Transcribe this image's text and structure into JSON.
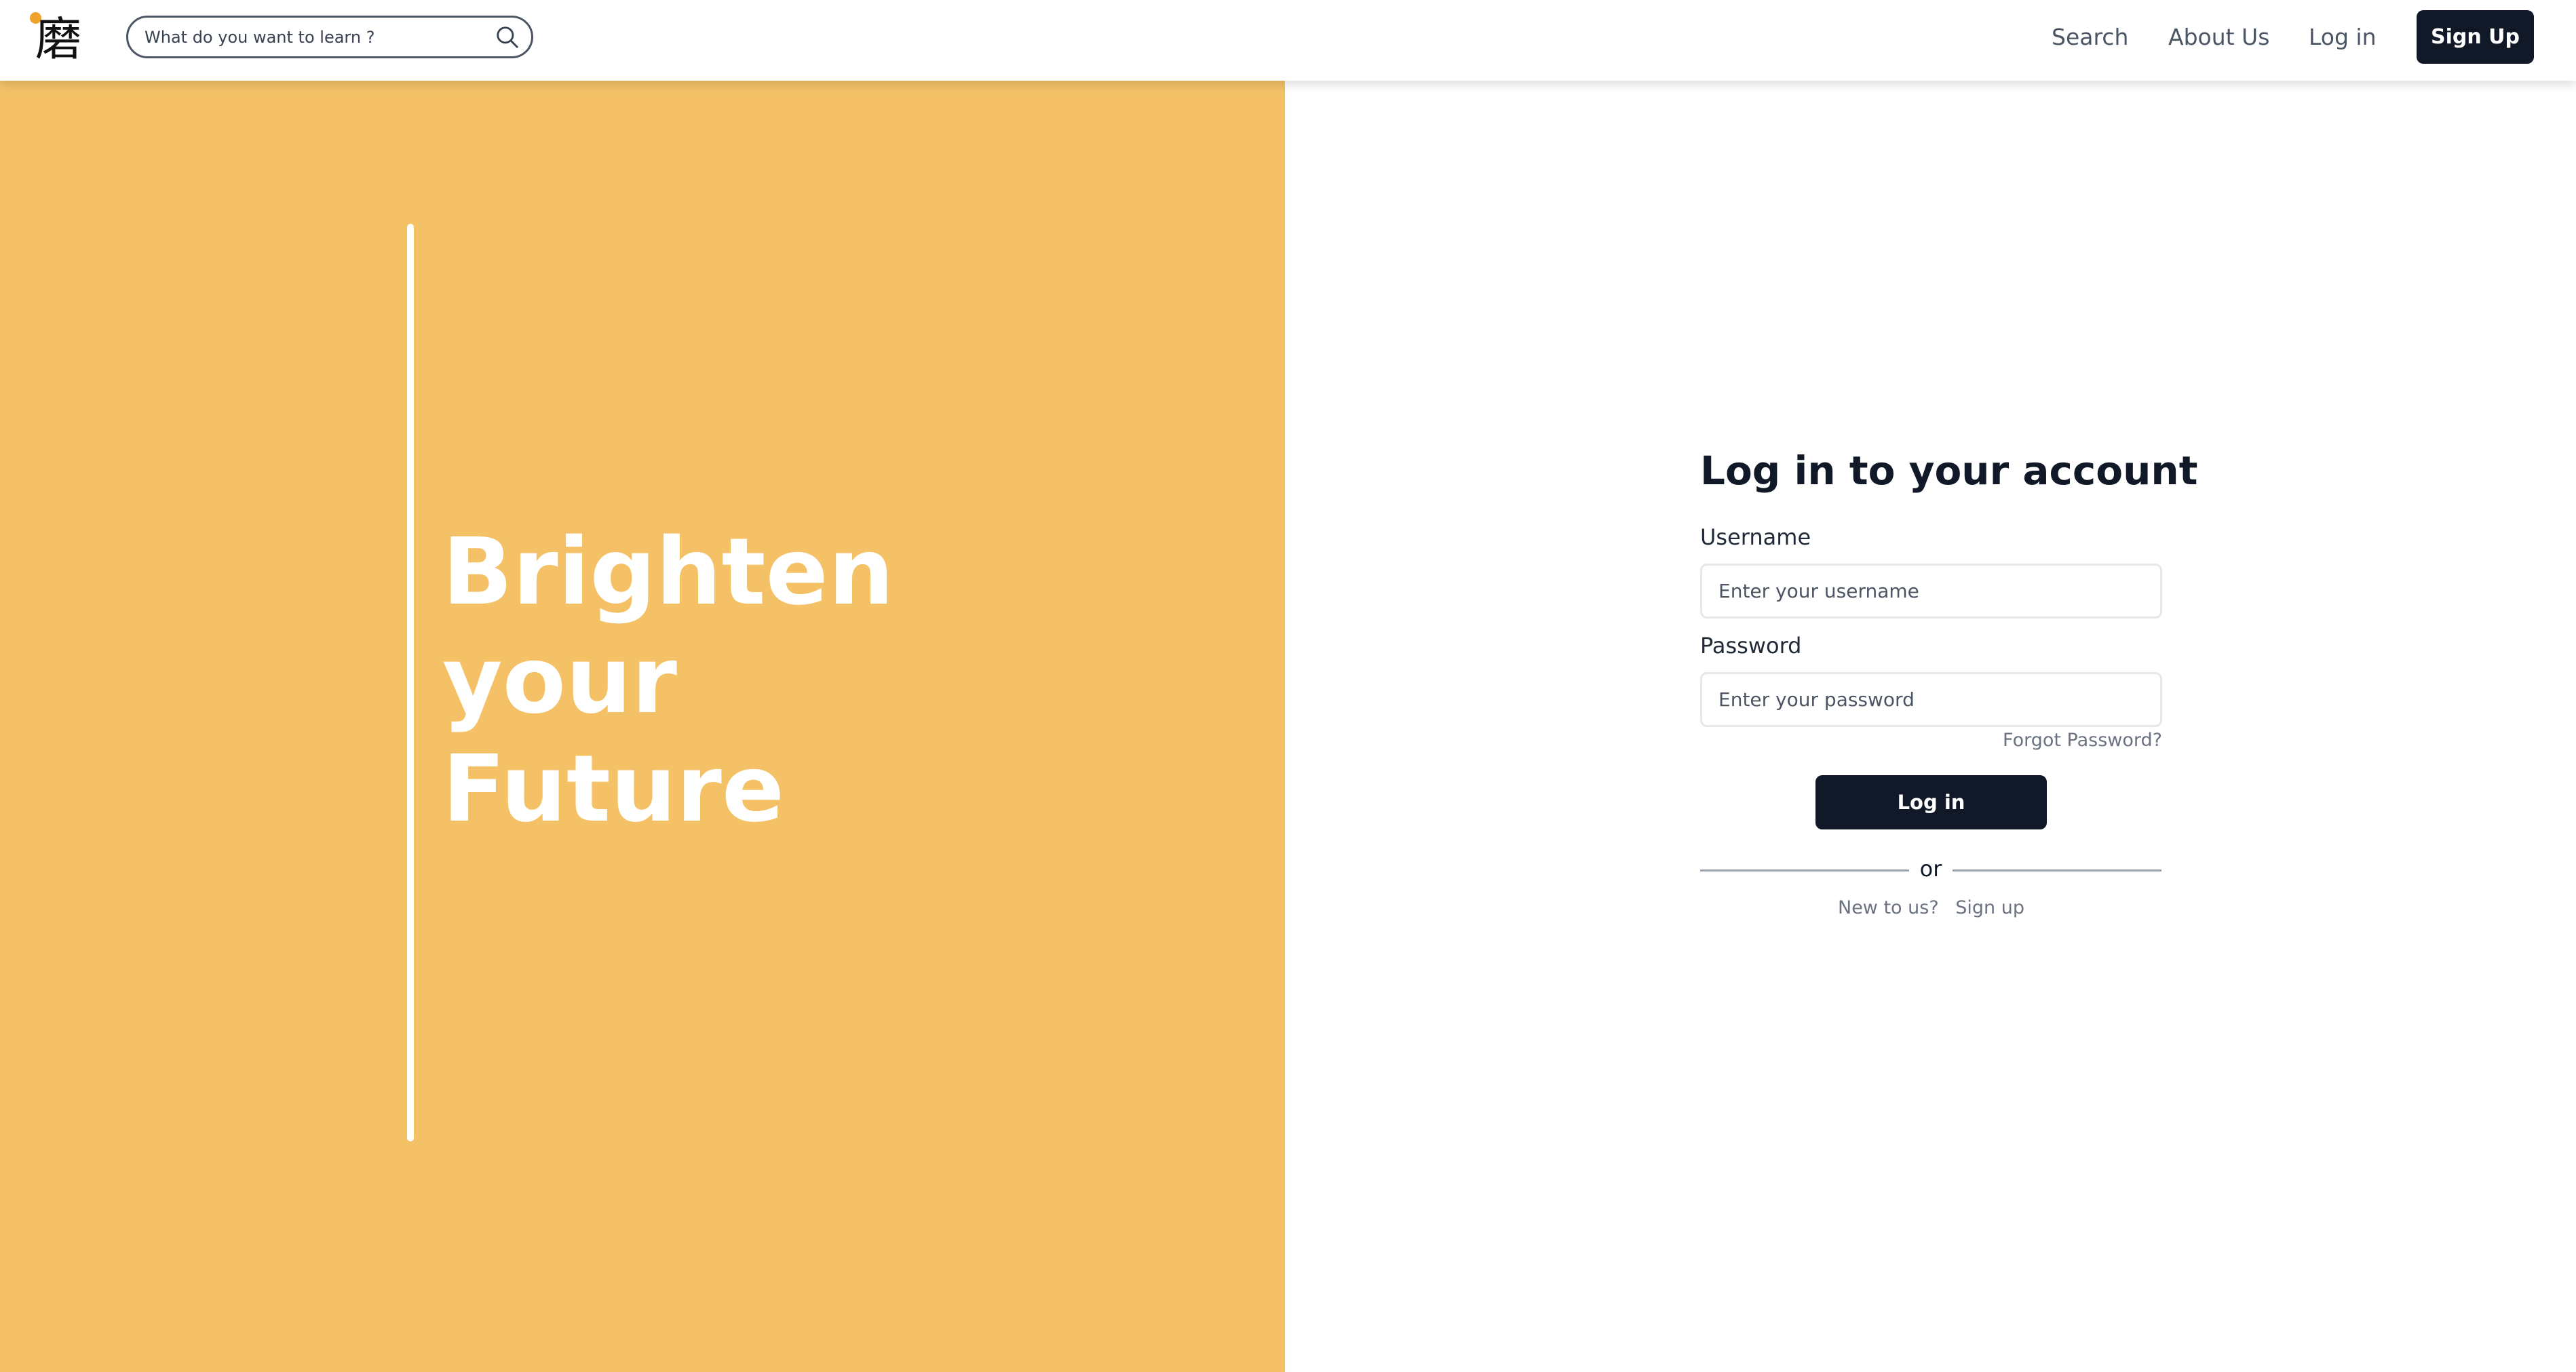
{
  "logo": {
    "glyph": "磨",
    "dot_color": "#f0a32a"
  },
  "search": {
    "placeholder": "What do you want to learn ?",
    "icon": "search-icon"
  },
  "nav": {
    "links": [
      {
        "label": "Search"
      },
      {
        "label": "About Us"
      },
      {
        "label": "Log in"
      }
    ],
    "signup_label": "Sign Up"
  },
  "hero": {
    "lines": [
      "Brighten",
      "your",
      "Future"
    ],
    "background": "#f4c167"
  },
  "login_form": {
    "title": "Log in to your account",
    "username_label": "Username",
    "username_placeholder": "Enter your username",
    "password_label": "Password",
    "password_placeholder": "Enter your password",
    "forgot_label": "Forgot Password?",
    "submit_label": "Log in",
    "divider_text": "or",
    "new_user_text": "New to us?",
    "signup_link": "Sign up"
  },
  "colors": {
    "primary_dark": "#111827",
    "accent": "#f4c167"
  }
}
